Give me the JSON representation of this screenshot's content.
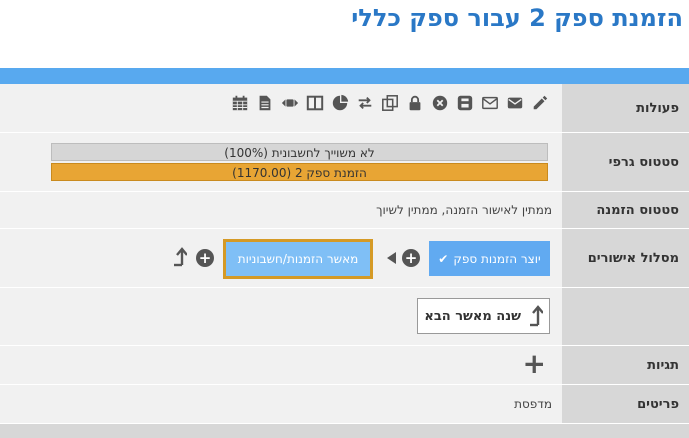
{
  "page": {
    "title": "הזמנת ספק 2 עבור ספק כללי"
  },
  "labels": {
    "actions": "פעולות",
    "graphic_status": "סטטוס גרפי",
    "order_status": "סטטוס הזמנה",
    "approval_path": "מסלול אישורים",
    "tags": "תגיות",
    "items": "פריטים"
  },
  "actions": {
    "icons": [
      "pencil-icon",
      "envelope-filled-icon",
      "envelope-outline-icon",
      "print-icon",
      "close-circle-icon",
      "lock-icon",
      "copy-icon",
      "exchange-icon",
      "pie-chart-icon",
      "columns-icon",
      "arrows-horizontal-icon",
      "document-icon",
      "calendar-icon"
    ]
  },
  "graphic_status": {
    "bar1_text": "לא משוייך לחשבונית (100%)",
    "bar2_text": "הזמנת ספק 2 (1170.00)",
    "bar1_color": "#d6d6d6",
    "bar2_color": "#e8a534"
  },
  "order_status": {
    "value": "ממתין לאישור הזמנה, ממתין לשיוך"
  },
  "approval_path": {
    "step1_label": "יוצר הזמנות ספק",
    "step2_label": "מאשר הזמנות/חשבוניות",
    "next_approver_label": "שנה מאשר הבא"
  },
  "items": {
    "value": "מדפסת"
  },
  "colors": {
    "accent": "#2a78c6",
    "bar": "#58a9ef",
    "highlight": "#d59a26"
  }
}
